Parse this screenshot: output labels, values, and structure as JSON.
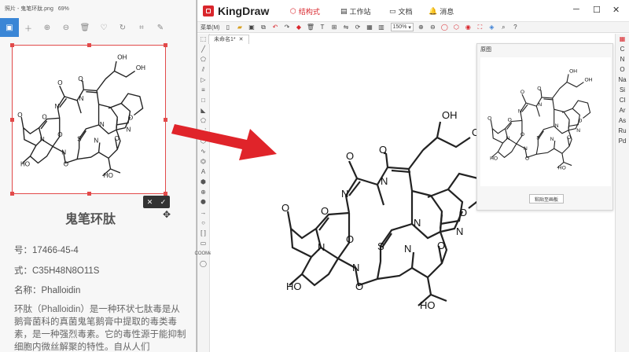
{
  "viewer": {
    "title": "照片 - 鬼笔环肽.png",
    "zoom": "69%",
    "compound_name": "鬼笔环肽",
    "cas_line": "号：17466-45-4",
    "formula_line": "式：C35H48N8O11S",
    "name_line": "名称：Phalloidin",
    "description": "环肽（Phalloidin）是一种环状七肽毒是从鹅膏菌科的真菌鬼笔鹅膏中提取的毒类毒素，是一种强烈毒素。它的毒性源于能抑制细胞内微丝解聚的特性。自从人们",
    "confirm_icon": "✓",
    "cancel_icon": "✕"
  },
  "kingdraw": {
    "app_name": "KingDraw",
    "tabs": [
      {
        "label": "结构式",
        "active": true
      },
      {
        "label": "工作站",
        "active": false
      },
      {
        "label": "文档",
        "active": false
      },
      {
        "label": "消息",
        "active": false
      }
    ],
    "menu_label": "菜单(M)",
    "zoom": "150%",
    "document_tab": "未命名1*",
    "elements": [
      "C",
      "N",
      "O",
      "Na",
      "Si",
      "Cl",
      "Ar",
      "As",
      "Ru",
      "Pd"
    ],
    "cooh_label": "COOMe",
    "original_panel": {
      "title": "原图",
      "paste_button": "粘贴至画板"
    }
  },
  "colors": {
    "accent": "#d9262c",
    "crop": "#e24a4a",
    "arrow": "#e0242a"
  }
}
